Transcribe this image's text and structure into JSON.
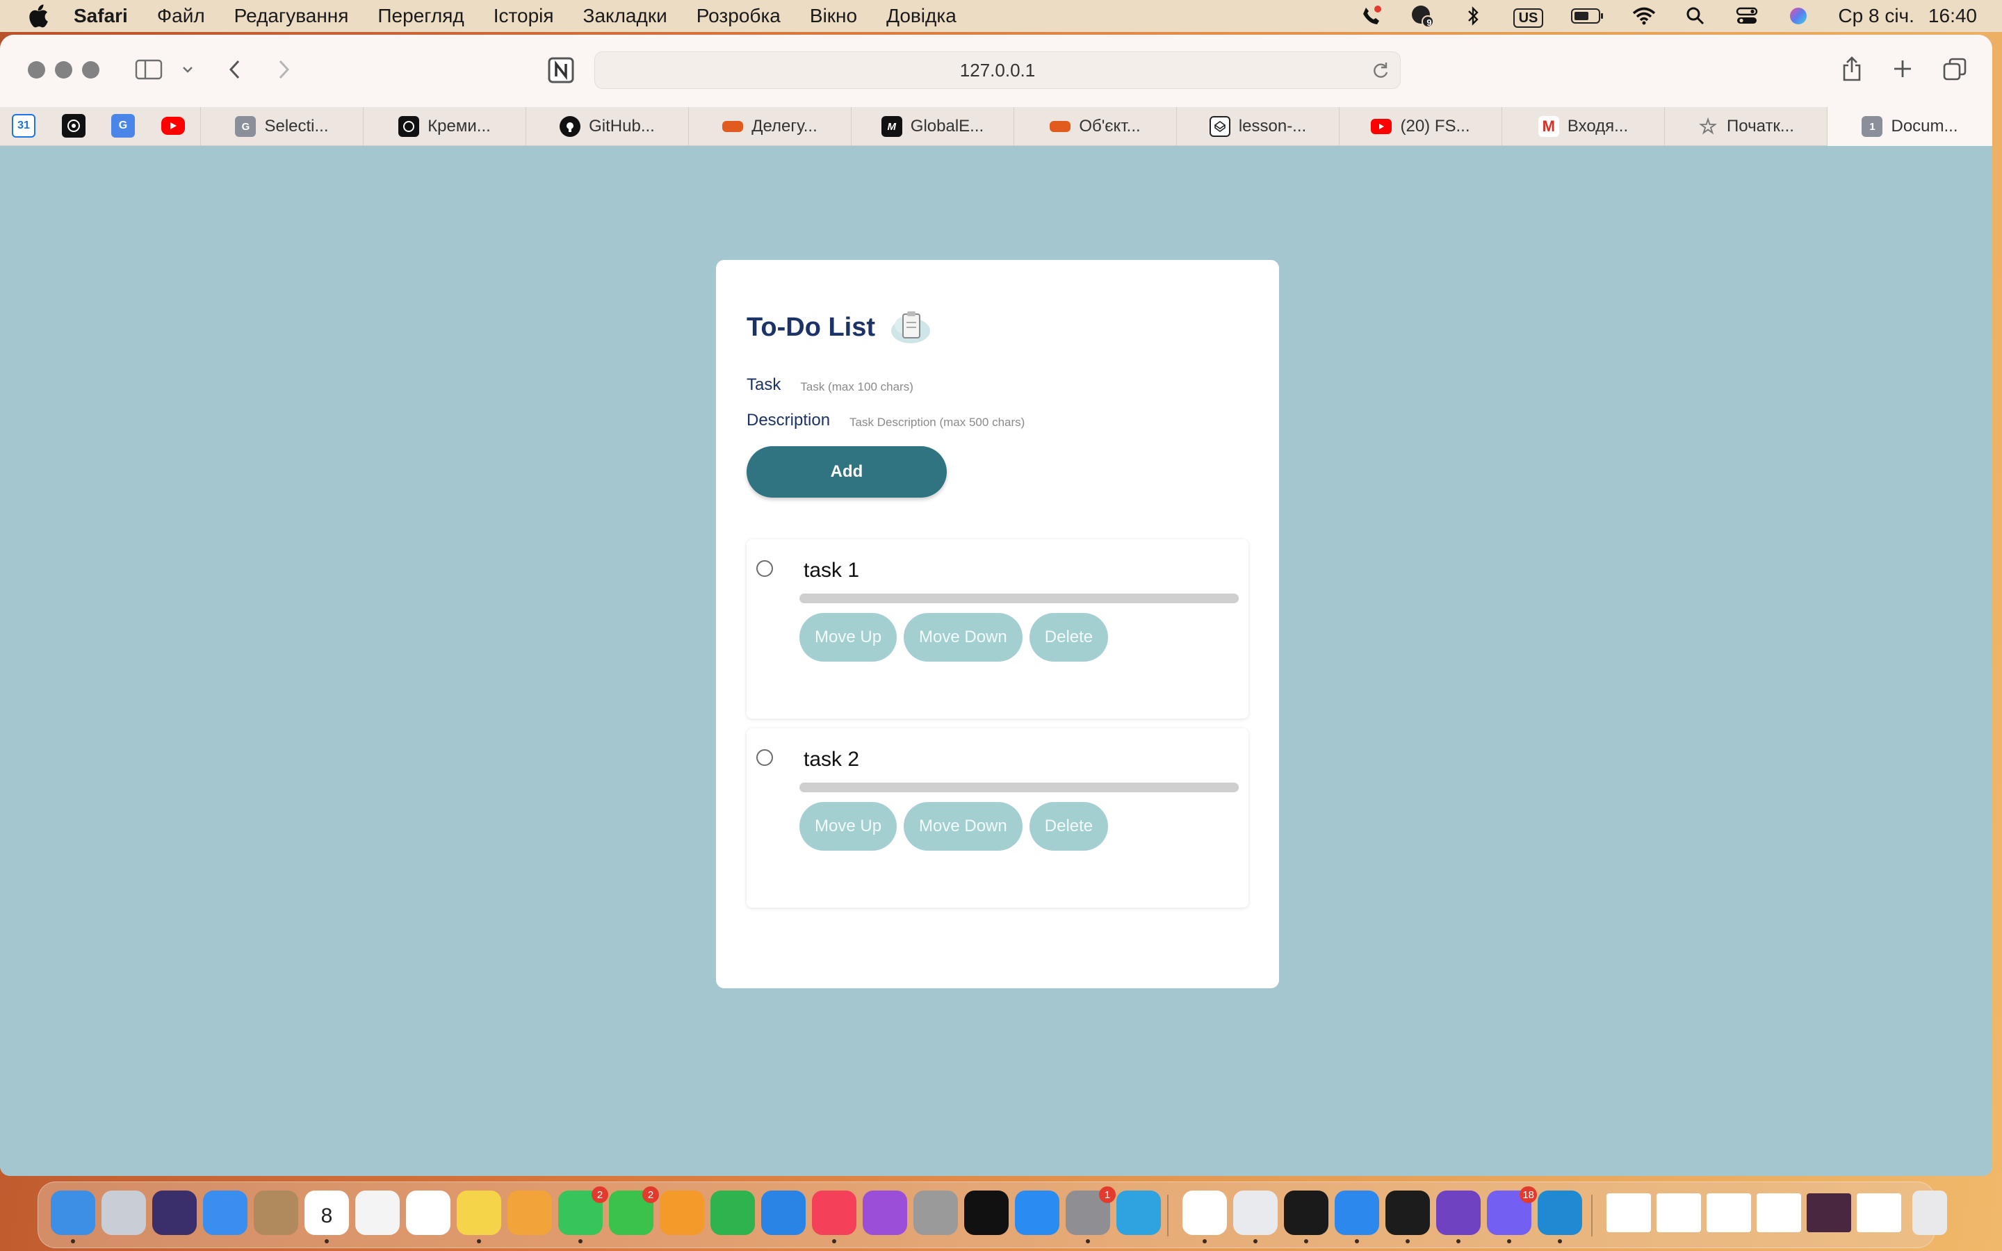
{
  "menubar": {
    "app_name": "Safari",
    "menus": [
      "Файл",
      "Редагування",
      "Перегляд",
      "Історія",
      "Закладки",
      "Розробка",
      "Вікно",
      "Довідка"
    ],
    "status": {
      "keyboard_layout": "US",
      "date": "Ср 8 січ.",
      "time": "16:40",
      "notification_badge": "9"
    }
  },
  "browser": {
    "url": "127.0.0.1",
    "pinned_tabs": [
      {
        "icon": "google-calendar-icon",
        "text": "31",
        "color": "#1a73e8"
      },
      {
        "icon": "chatgpt-icon",
        "text": "",
        "color": "#111111"
      },
      {
        "icon": "google-translate-icon",
        "text": "G",
        "color": "#4a86e8"
      },
      {
        "icon": "youtube-icon",
        "text": "",
        "color": "#ff0000"
      }
    ],
    "tabs": [
      {
        "label": "Selecti...",
        "icon": "grammarly-icon",
        "fav_text": "G",
        "color": "#8a8f9a"
      },
      {
        "label": "Креми...",
        "icon": "chatgpt-icon",
        "fav_text": "",
        "color": "#111111"
      },
      {
        "label": "GitHub...",
        "icon": "github-icon",
        "fav_text": "",
        "color": "#111111"
      },
      {
        "label": "Делегу...",
        "icon": "hotline-icon",
        "fav_text": "",
        "color": "#e25b1e"
      },
      {
        "label": "GlobalE...",
        "icon": "medium-icon",
        "fav_text": "M",
        "color": "#111111"
      },
      {
        "label": "Об'єкт...",
        "icon": "hotline-icon",
        "fav_text": "",
        "color": "#e25b1e"
      },
      {
        "label": "lesson-...",
        "icon": "codepen-icon",
        "fav_text": "",
        "color": "#222222"
      },
      {
        "label": "(20) FS...",
        "icon": "youtube-icon",
        "fav_text": "",
        "color": "#ff0000"
      },
      {
        "label": "Входя...",
        "icon": "gmail-icon",
        "fav_text": "M",
        "color": "#d93025"
      },
      {
        "label": "Початк...",
        "icon": "star-icon",
        "fav_text": "☆",
        "color": "#777777"
      },
      {
        "label": "Docum...",
        "icon": "page-number-icon",
        "fav_text": "1",
        "color": "#8a8f9a"
      }
    ]
  },
  "app": {
    "title": "To-Do List",
    "form": {
      "task_label": "Task",
      "task_placeholder": "Task (max 100 chars)",
      "description_label": "Description",
      "description_placeholder": "Task Description (max 500 chars)",
      "add_button": "Add"
    },
    "tasks": [
      {
        "name": "task 1",
        "buttons": {
          "up": "Move Up",
          "down": "Move Down",
          "delete": "Delete"
        }
      },
      {
        "name": "task 2",
        "buttons": {
          "up": "Move Up",
          "down": "Move Down",
          "delete": "Delete"
        }
      }
    ]
  },
  "dock": {
    "apps": [
      {
        "name": "finder-icon",
        "color": "#3d8fe6",
        "running": true
      },
      {
        "name": "launchpad-icon",
        "color": "#c9cdd6",
        "running": false
      },
      {
        "name": "siri-icon",
        "color": "#3a2f6b",
        "running": false
      },
      {
        "name": "mail-icon",
        "color": "#3a8ef0",
        "running": false
      },
      {
        "name": "contacts-icon",
        "color": "#b08a5c",
        "running": false
      },
      {
        "name": "calendar-icon",
        "color": "#ffffff",
        "running": true,
        "label": "8"
      },
      {
        "name": "freeform-icon",
        "color": "#f4f4f4",
        "running": false
      },
      {
        "name": "reminders-icon",
        "color": "#ffffff",
        "running": false
      },
      {
        "name": "notes-icon",
        "color": "#f6d44a",
        "running": true
      },
      {
        "name": "photos-icon",
        "color": "#f2a33a",
        "running": false
      },
      {
        "name": "messages-icon",
        "color": "#37c45a",
        "running": true,
        "badge": "2"
      },
      {
        "name": "facetime-icon",
        "color": "#3bc24d",
        "running": false,
        "badge": "2"
      },
      {
        "name": "pages-icon",
        "color": "#f39a2a",
        "running": false
      },
      {
        "name": "numbers-icon",
        "color": "#2eb34e",
        "running": false
      },
      {
        "name": "keynote-icon",
        "color": "#2a84e6",
        "running": false
      },
      {
        "name": "music-icon",
        "color": "#f5405a",
        "running": true
      },
      {
        "name": "podcasts-icon",
        "color": "#9b4fd8",
        "running": false
      },
      {
        "name": "calculator-icon",
        "color": "#9a9a9a",
        "running": false
      },
      {
        "name": "tv-icon",
        "color": "#111111",
        "running": false
      },
      {
        "name": "app-store-icon",
        "color": "#2a8cf0",
        "running": false
      },
      {
        "name": "system-settings-icon",
        "color": "#8e8e93",
        "running": true,
        "badge": "1"
      },
      {
        "name": "telegram-icon",
        "color": "#2ea3e0",
        "running": false
      },
      {
        "name": "slack-icon",
        "color": "#ffffff",
        "running": true
      },
      {
        "name": "chrome-icon",
        "color": "#e8eaed",
        "running": true
      },
      {
        "name": "activity-monitor-icon",
        "color": "#1a1a1a",
        "running": true
      },
      {
        "name": "safari-icon",
        "color": "#2d88ee",
        "running": true
      },
      {
        "name": "terminal-icon",
        "color": "#1c1c1c",
        "running": true
      },
      {
        "name": "github-desktop-icon",
        "color": "#6f42c1",
        "running": true
      },
      {
        "name": "viber-icon",
        "color": "#7360f2",
        "running": true,
        "badge": "18"
      },
      {
        "name": "vscode-icon",
        "color": "#1f8ad2",
        "running": true
      }
    ]
  },
  "colors": {
    "page_background": "#a3c6cf",
    "title_color": "#1b3366",
    "add_button": "#2f7480",
    "task_button": "#a3cfd1"
  }
}
